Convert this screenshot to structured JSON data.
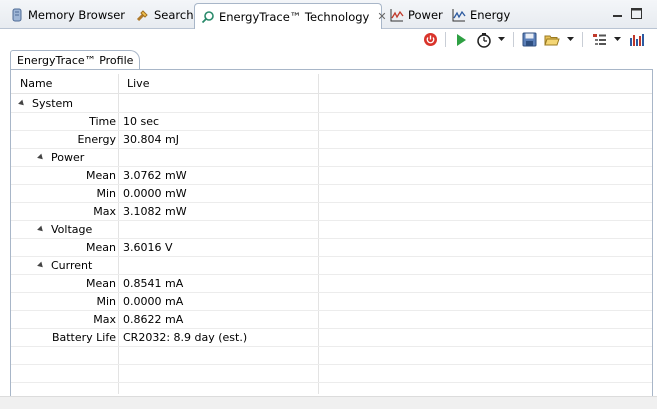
{
  "tabs": [
    {
      "label": "Memory Browser",
      "icon": "memory-icon"
    },
    {
      "label": "Search",
      "icon": "flashlight-icon"
    },
    {
      "label": "EnergyTrace™ Technology",
      "icon": "energytrace-icon",
      "active": true
    },
    {
      "label": "Power",
      "icon": "power-graph-icon"
    },
    {
      "label": "Energy",
      "icon": "energy-graph-icon"
    }
  ],
  "inner_tab": "EnergyTrace™ Profile",
  "columns": [
    "Name",
    "Live"
  ],
  "rows": [
    {
      "name": "System",
      "value": "",
      "level": 0,
      "expanded": true
    },
    {
      "name": "Time",
      "value": "10 sec",
      "level": 1
    },
    {
      "name": "Energy",
      "value": "30.804 mJ",
      "level": 1
    },
    {
      "name": "Power",
      "value": "",
      "level": 1,
      "expanded": true
    },
    {
      "name": "Mean",
      "value": "3.0762 mW",
      "level": 2
    },
    {
      "name": "Min",
      "value": "0.0000 mW",
      "level": 2
    },
    {
      "name": "Max",
      "value": "3.1082 mW",
      "level": 2
    },
    {
      "name": "Voltage",
      "value": "",
      "level": 1,
      "expanded": true
    },
    {
      "name": "Mean",
      "value": "3.6016 V",
      "level": 2
    },
    {
      "name": "Current",
      "value": "",
      "level": 1,
      "expanded": true
    },
    {
      "name": "Mean",
      "value": "0.8541 mA",
      "level": 2
    },
    {
      "name": "Min",
      "value": "0.0000 mA",
      "level": 2
    },
    {
      "name": "Max",
      "value": "0.8622 mA",
      "level": 2
    },
    {
      "name": "Battery Life",
      "value": "CR2032: 8.9 day (est.)",
      "level": 1
    }
  ],
  "colors": {
    "stop": "#d9342b",
    "play": "#2ea043",
    "accent_border": "#a8b6c8"
  }
}
